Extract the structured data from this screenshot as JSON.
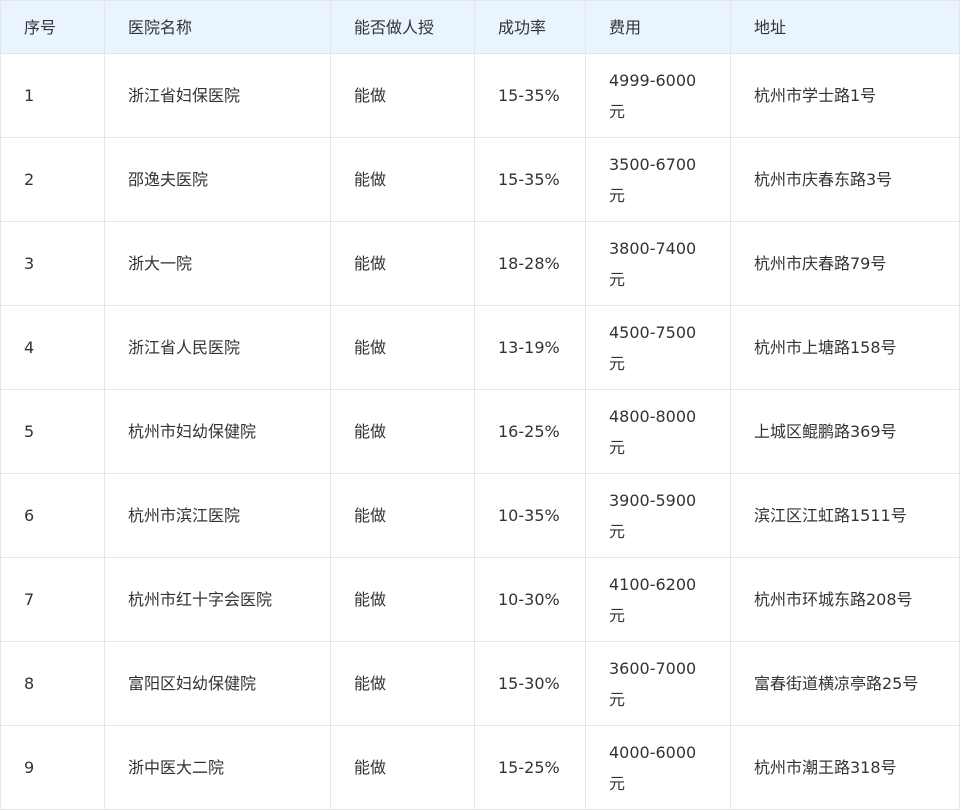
{
  "table": {
    "headers": [
      "序号",
      "医院名称",
      "能否做人授",
      "成功率",
      "费用",
      "地址"
    ],
    "rows": [
      [
        "1",
        "浙江省妇保医院",
        "能做",
        "15-35%",
        "4999-6000元",
        "杭州市学士路1号"
      ],
      [
        "2",
        "邵逸夫医院",
        "能做",
        "15-35%",
        "3500-6700元",
        "杭州市庆春东路3号"
      ],
      [
        "3",
        "浙大一院",
        "能做",
        "18-28%",
        "3800-7400元",
        "杭州市庆春路79号"
      ],
      [
        "4",
        "浙江省人民医院",
        "能做",
        "13-19%",
        "4500-7500元",
        "杭州市上塘路158号"
      ],
      [
        "5",
        "杭州市妇幼保健院",
        "能做",
        "16-25%",
        "4800-8000元",
        "上城区鲲鹏路369号"
      ],
      [
        "6",
        "杭州市滨江医院",
        "能做",
        "10-35%",
        "3900-5900元",
        "滨江区江虹路1511号"
      ],
      [
        "7",
        "杭州市红十字会医院",
        "能做",
        "10-30%",
        "4100-6200元",
        "杭州市环城东路208号"
      ],
      [
        "8",
        "富阳区妇幼保健院",
        "能做",
        "15-30%",
        "3600-7000元",
        "富春街道横凉亭路25号"
      ],
      [
        "9",
        "浙中医大二院",
        "能做",
        "15-25%",
        "4000-6000元",
        "杭州市潮王路318号"
      ]
    ]
  }
}
